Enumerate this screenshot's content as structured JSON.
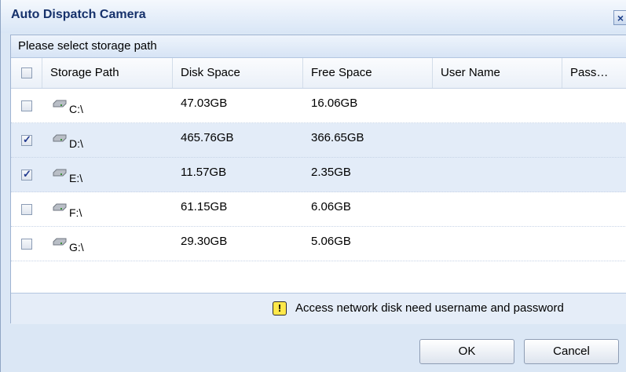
{
  "dialog": {
    "title": "Auto Dispatch Camera",
    "close_glyph": "×",
    "panel_title": "Please select storage path",
    "columns": [
      "Storage Path",
      "Disk Space",
      "Free Space",
      "User Name",
      "Pass…"
    ],
    "rows": [
      {
        "path": "C:\\",
        "disk_space": "47.03GB",
        "free_space": "16.06GB",
        "checked": false
      },
      {
        "path": "D:\\",
        "disk_space": "465.76GB",
        "free_space": "366.65GB",
        "checked": true
      },
      {
        "path": "E:\\",
        "disk_space": "11.57GB",
        "free_space": "2.35GB",
        "checked": true
      },
      {
        "path": "F:\\",
        "disk_space": "61.15GB",
        "free_space": "6.06GB",
        "checked": false
      },
      {
        "path": "G:\\",
        "disk_space": "29.30GB",
        "free_space": "5.06GB",
        "checked": false
      }
    ],
    "warning_glyph": "!",
    "warning_text": "Access network disk need username and password",
    "ok_label": "OK",
    "cancel_label": "Cancel"
  },
  "colors": {
    "title_text": "#16316b",
    "selected_row": "#e3ecf8",
    "dialog_bg": "#dbe7f5",
    "warning_icon": "#ffe84a"
  },
  "icons": [
    "close-icon",
    "drive-icon",
    "warning-icon"
  ]
}
